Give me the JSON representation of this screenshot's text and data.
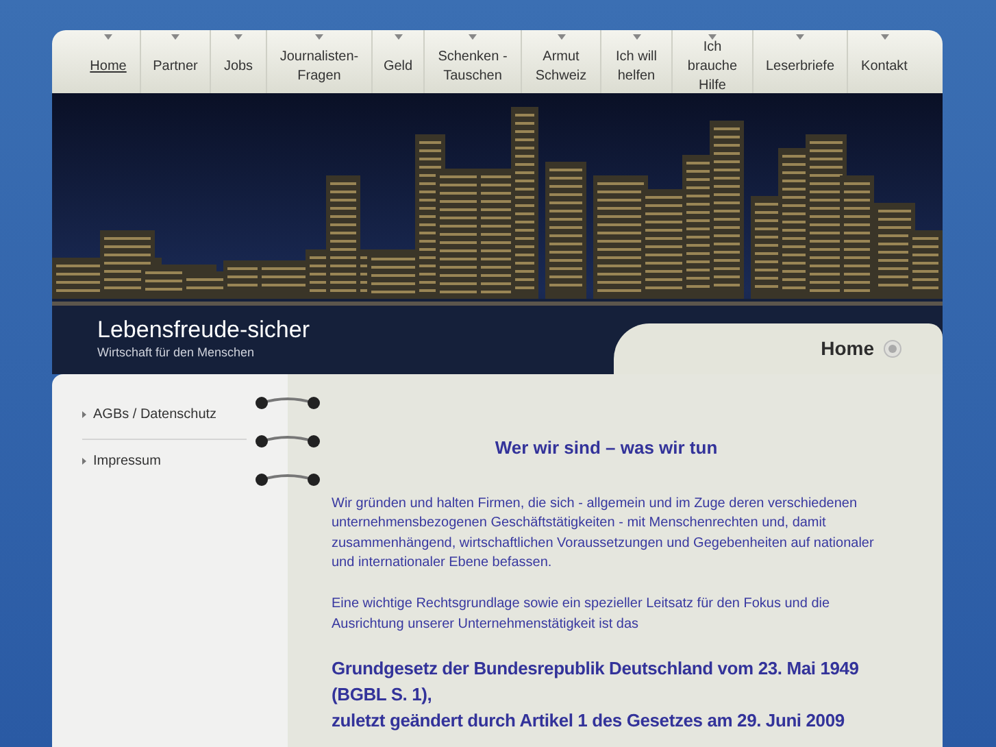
{
  "nav": [
    {
      "label": "Home",
      "selected": true
    },
    {
      "label": "Partner",
      "selected": false
    },
    {
      "label": "Jobs",
      "selected": false
    },
    {
      "label": "Journalisten-Fragen",
      "selected": false
    },
    {
      "label": "Geld",
      "selected": false
    },
    {
      "label": "Schenken - Tauschen",
      "selected": false
    },
    {
      "label": "Armut Schweiz",
      "selected": false
    },
    {
      "label": "Ich will helfen",
      "selected": false
    },
    {
      "label": "Ich brauche Hilfe",
      "selected": false
    },
    {
      "label": "Leserbriefe",
      "selected": false
    },
    {
      "label": "Kontakt",
      "selected": false
    }
  ],
  "header": {
    "site_title": "Lebensfreude-sicher",
    "tagline": "Wirtschaft für den Menschen",
    "page_tab": "Home"
  },
  "sidebar": {
    "items": [
      "AGBs / Datenschutz",
      "Impressum"
    ]
  },
  "content": {
    "heading": "Wer wir sind – was wir tun",
    "paragraphs": [
      "Wir gründen und halten Firmen, die sich - allgemein und im Zuge deren verschiedenen unternehmensbezogenen Geschäftstätigkeiten - mit Menschenrechten und, damit zusammenhängend, wirtschaftlichen Voraussetzungen und Gegebenheiten auf nationaler und internationaler Ebene befassen.",
      "Eine wichtige Rechtsgrundlage sowie ein spezieller Leitsatz für den Fokus und die Ausrichtung unserer Unternehmenstätigkeit ist das"
    ],
    "law_title": [
      "Grundgesetz der Bundesrepublik Deutschland vom 23. Mai 1949 (BGBL S. 1),",
      "zuletzt geändert durch Artikel 1 des Gesetzes am 29. Juni 2009"
    ]
  }
}
